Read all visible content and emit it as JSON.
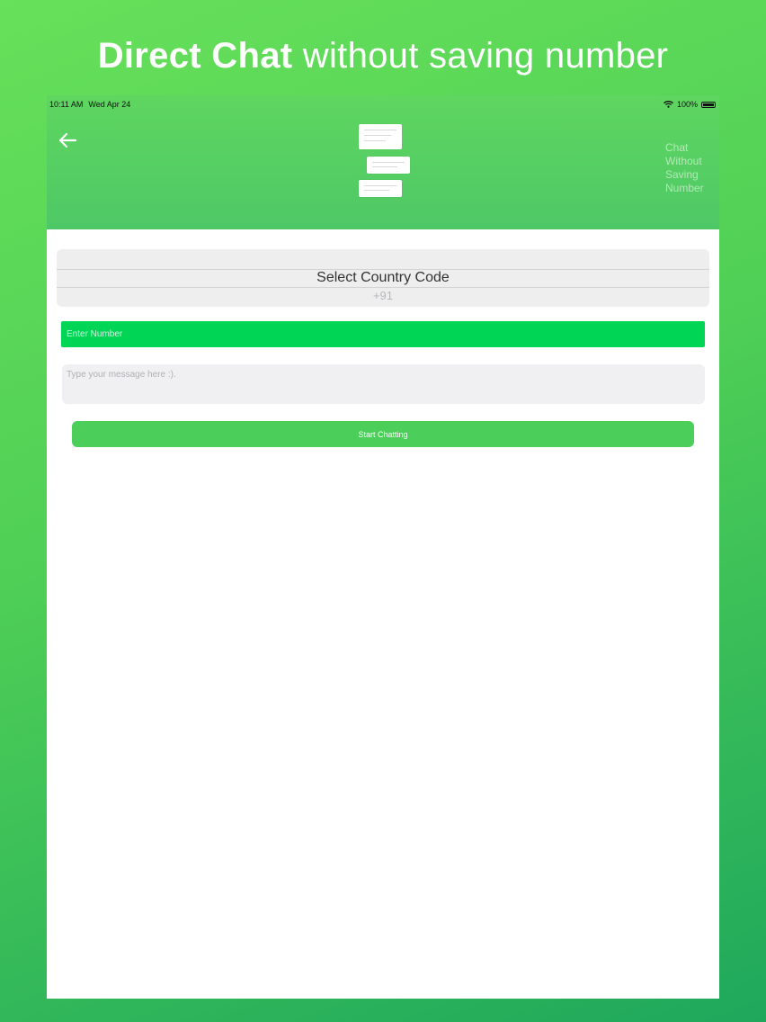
{
  "promo": {
    "bold": "Direct Chat",
    "rest": " without saving number"
  },
  "status_bar": {
    "time": "10:11 AM",
    "date": "Wed Apr 24",
    "battery": "100%"
  },
  "header": {
    "side_title_lines": [
      "Chat",
      "Without",
      "Saving",
      "Number"
    ],
    "logo_icon": "chat-bubbles-icon",
    "back_icon": "back-arrow-icon"
  },
  "picker": {
    "label": "Select Country Code",
    "value": "+91"
  },
  "number_field": {
    "placeholder": "Enter Number",
    "value": ""
  },
  "message_field": {
    "placeholder": "Type your message here :).",
    "value": ""
  },
  "start_button": {
    "label": "Start Chatting"
  },
  "colors": {
    "accent": "#00d556",
    "header": "#55cf62",
    "button": "#4ccf5a"
  }
}
